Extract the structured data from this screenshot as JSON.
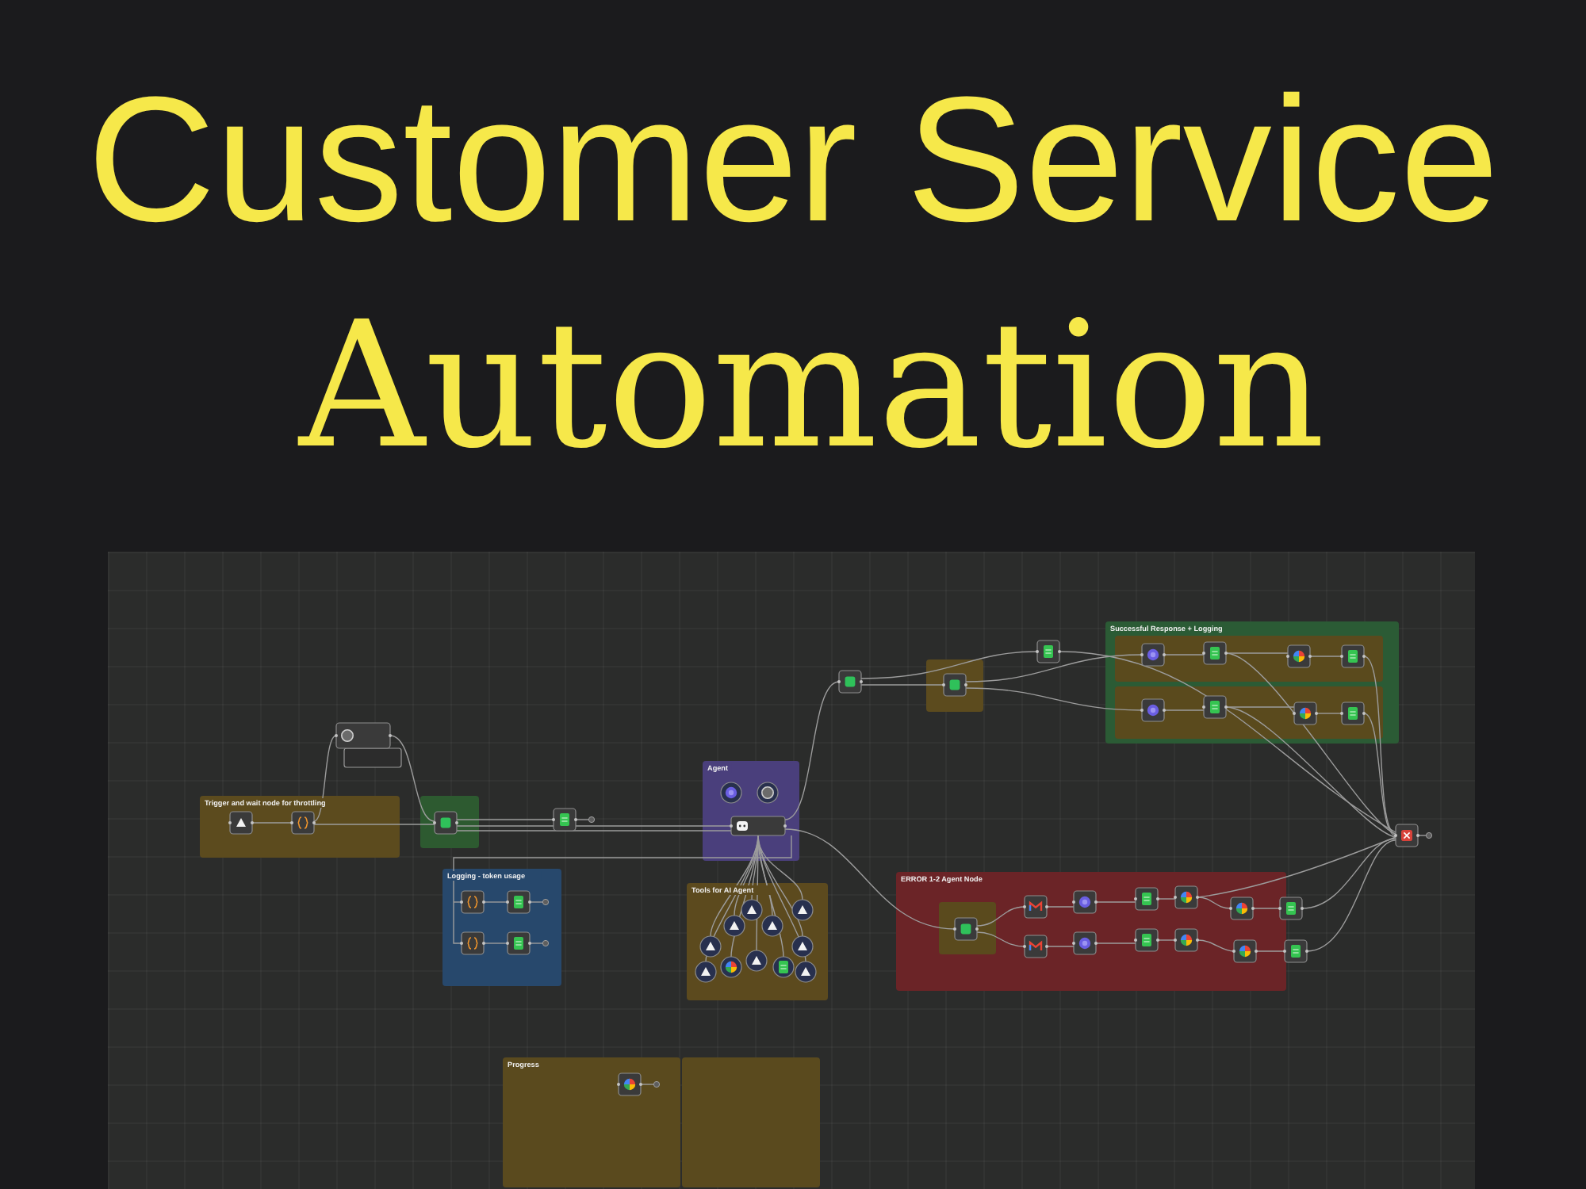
{
  "title": {
    "line_1": "Customer Service",
    "line_2": "Automation"
  },
  "workflow": {
    "groups": [
      {
        "title": "Trigger and wait node for throttling",
        "color": "#5c4b1e"
      },
      {
        "color": "#2d5a30"
      },
      {
        "title": "Agent",
        "color": "#4a3f7c"
      },
      {
        "title": "Logging - token usage",
        "color": "#27486c"
      },
      {
        "title": "Tools for AI Agent",
        "color": "#5c4a1e"
      },
      {
        "color": "#5c4b1e"
      },
      {
        "title": "Successful Response + Logging",
        "color": "#2b5b35"
      },
      {
        "color": "#5a4a1d"
      },
      {
        "color": "#5a4a1d"
      },
      {
        "title": "ERROR 1-2 Agent Node",
        "color": "#6b2427"
      },
      {
        "color": "#5a4a1d"
      },
      {
        "title": "Progress",
        "color": "#5a4a1e"
      },
      {
        "color": "#5a4a1e"
      }
    ]
  }
}
